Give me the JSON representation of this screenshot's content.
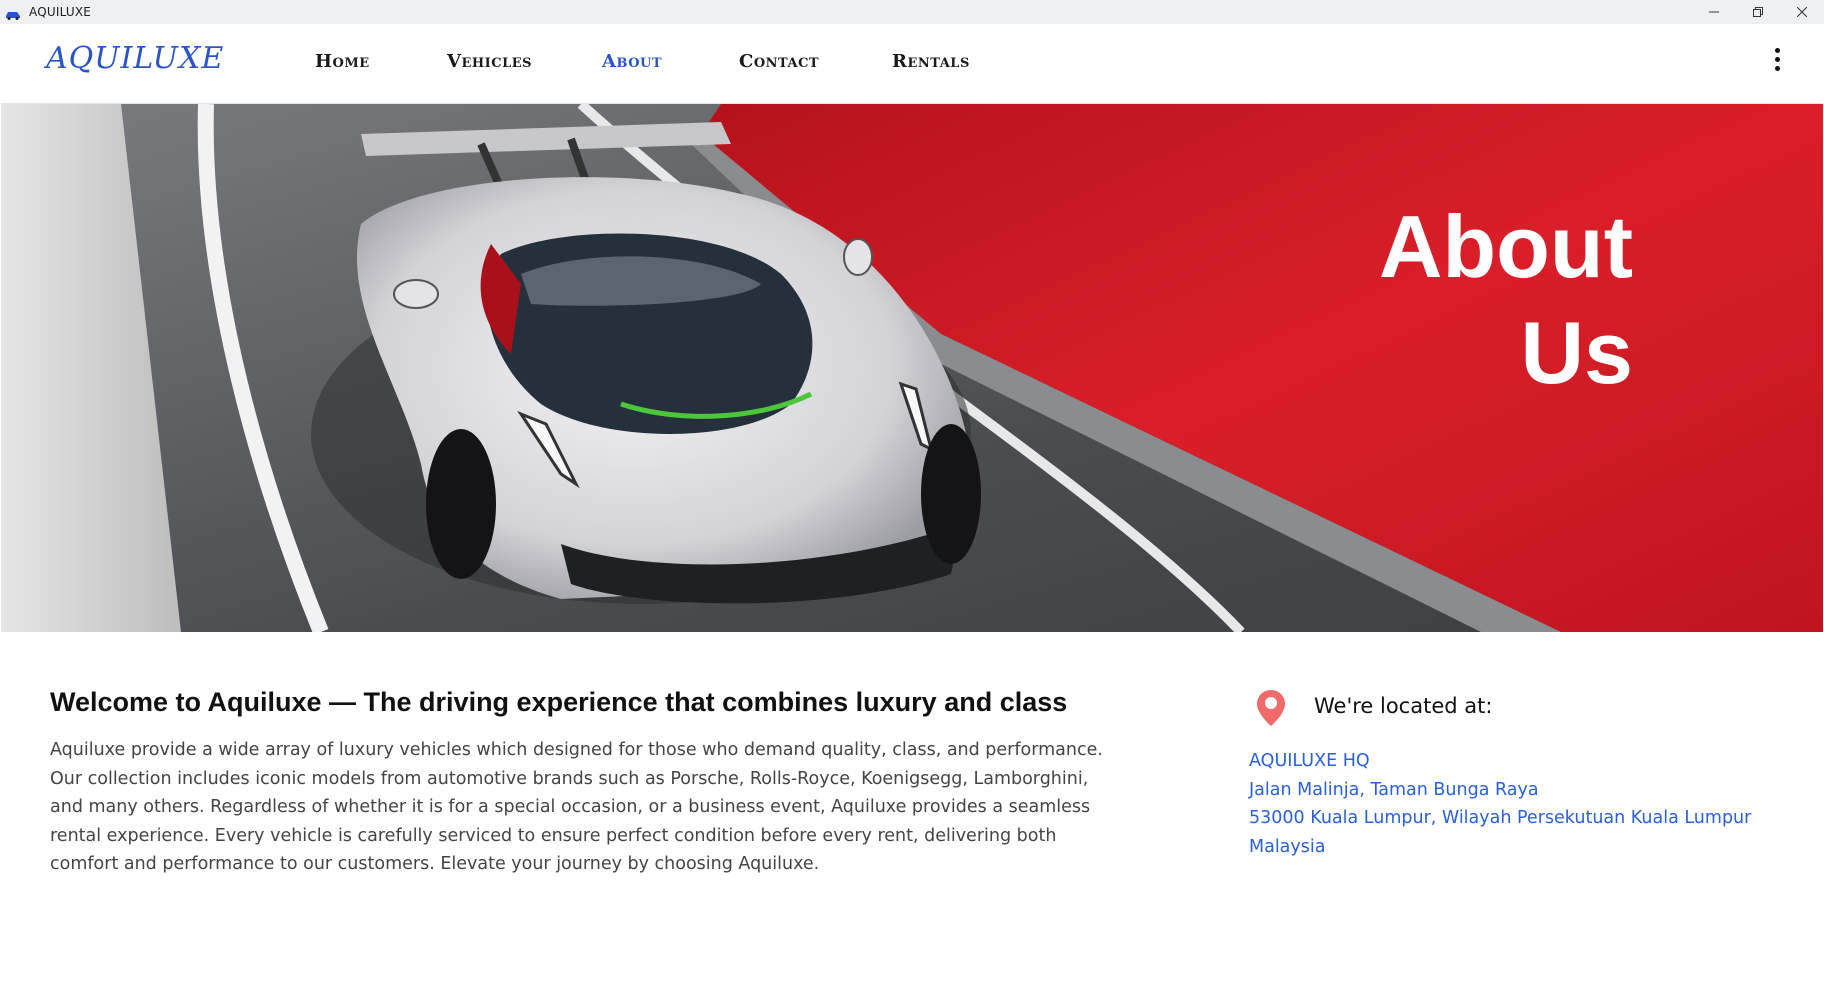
{
  "window": {
    "title": "AQUILUXE"
  },
  "nav": {
    "logo": "AQUILUXE",
    "items": [
      {
        "label": "Home",
        "active": false
      },
      {
        "label": "Vehicles",
        "active": false
      },
      {
        "label": "About",
        "active": true
      },
      {
        "label": "Contact",
        "active": false
      },
      {
        "label": "Rentals",
        "active": false
      }
    ],
    "menu_icon": "kebab-menu-icon"
  },
  "hero": {
    "title_line1": "About",
    "title_line2": "Us",
    "image_subject": "white supercar on race track with red wall"
  },
  "welcome": {
    "title": "Welcome to Aquiluxe — The driving experience that combines luxury and class",
    "body_lines": [
      "Aquiluxe provide a wide array of luxury vehicles which designed for those who demand quality, class, and performance.",
      "Our collection includes iconic models from automotive brands such as Porsche, Rolls-Royce, Koenigsegg, Lamborghini,",
      "and many others. Regardless of whether it is for a special occasion, or a business event, Aquiluxe provides a seamless",
      "rental experience. Every vehicle is carefully serviced to ensure perfect condition before every rent, delivering both",
      "comfort and performance to our customers. Elevate your journey by choosing Aquiluxe."
    ]
  },
  "location": {
    "heading": "We're located at:",
    "icon": "map-pin-icon",
    "address_lines": [
      "AQUILUXE HQ",
      "Jalan Malinja, Taman Bunga Raya",
      "53000 Kuala Lumpur, Wilayah Persekutuan Kuala Lumpur",
      "Malaysia"
    ]
  },
  "colors": {
    "accent": "#2a55c8",
    "link": "#2a60d8",
    "hero_red": "#d41f28",
    "pin": "#f06a6a"
  }
}
